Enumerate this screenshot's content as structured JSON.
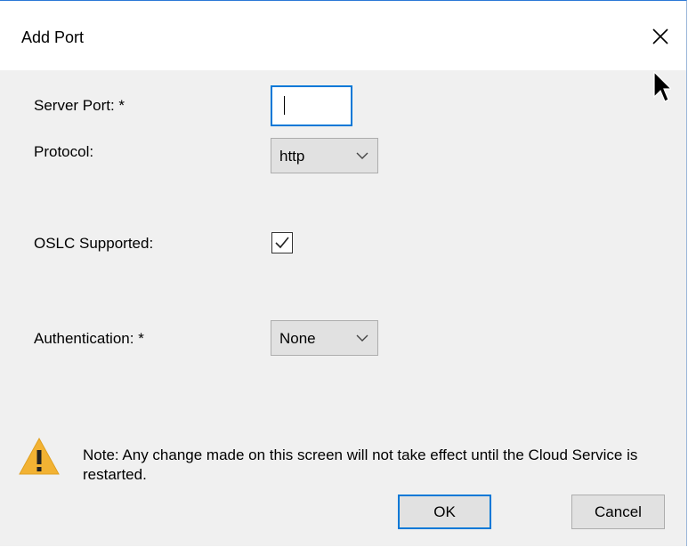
{
  "dialog": {
    "title": "Add Port",
    "close_icon": "close-icon"
  },
  "form": {
    "server_port_label": "Server Port: *",
    "server_port_value": "",
    "protocol_label": "Protocol:",
    "protocol_value": "http",
    "oslc_label": "OSLC Supported:",
    "oslc_checked": true,
    "auth_label": "Authentication: *",
    "auth_value": "None"
  },
  "note": {
    "icon": "warning-icon",
    "text": "Note: Any change made on this screen will not take effect until the Cloud Service is restarted."
  },
  "buttons": {
    "ok_label": "OK",
    "cancel_label": "Cancel"
  },
  "colors": {
    "accent": "#0078d7",
    "warning": "#f2b233",
    "dialog_bg": "#f0f0f0",
    "button_bg": "#e1e1e1"
  }
}
